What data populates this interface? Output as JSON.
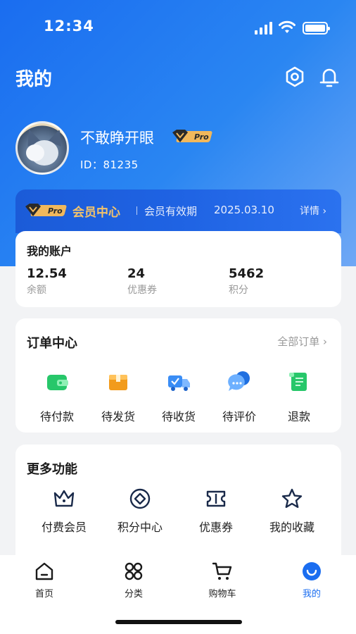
{
  "status_bar": {
    "time": "12:34"
  },
  "header": {
    "title": "我的"
  },
  "profile": {
    "name": "不敢睁开眼",
    "badge": "Pro",
    "id_text": "ID：81235"
  },
  "vip": {
    "badge": "Pro",
    "title": "会员中心",
    "expiry_label": "会员有效期",
    "expiry_date": "2025.03.10",
    "detail_label": "详情 ›"
  },
  "account": {
    "title": "我的账户",
    "stats": [
      {
        "value": "12.54",
        "label": "余额"
      },
      {
        "value": "24",
        "label": "优惠券"
      },
      {
        "value": "5462",
        "label": "积分"
      }
    ]
  },
  "orders": {
    "title": "订单中心",
    "all_label": "全部订单 ›",
    "items": [
      {
        "label": "待付款",
        "icon": "wallet-icon",
        "color": "#2ecc71"
      },
      {
        "label": "待发货",
        "icon": "package-icon",
        "color": "#f39c12"
      },
      {
        "label": "待收货",
        "icon": "delivery-truck-icon",
        "color": "#3a8df5"
      },
      {
        "label": "待评价",
        "icon": "chat-bubble-icon",
        "color": "#3a8df5"
      },
      {
        "label": "退款",
        "icon": "refund-receipt-icon",
        "color": "#2ecc71"
      }
    ]
  },
  "more": {
    "title": "更多功能",
    "items": [
      {
        "label": "付费会员",
        "icon": "crown-icon"
      },
      {
        "label": "积分中心",
        "icon": "points-coin-icon"
      },
      {
        "label": "优惠券",
        "icon": "coupon-icon"
      },
      {
        "label": "我的收藏",
        "icon": "star-icon"
      }
    ]
  },
  "tabs": [
    {
      "label": "首页",
      "icon": "home-icon"
    },
    {
      "label": "分类",
      "icon": "category-grid-icon"
    },
    {
      "label": "购物车",
      "icon": "cart-icon"
    },
    {
      "label": "我的",
      "icon": "profile-smile-icon",
      "active": true
    }
  ],
  "colors": {
    "primary": "#1a6df0",
    "gold": "#f3c36c"
  }
}
